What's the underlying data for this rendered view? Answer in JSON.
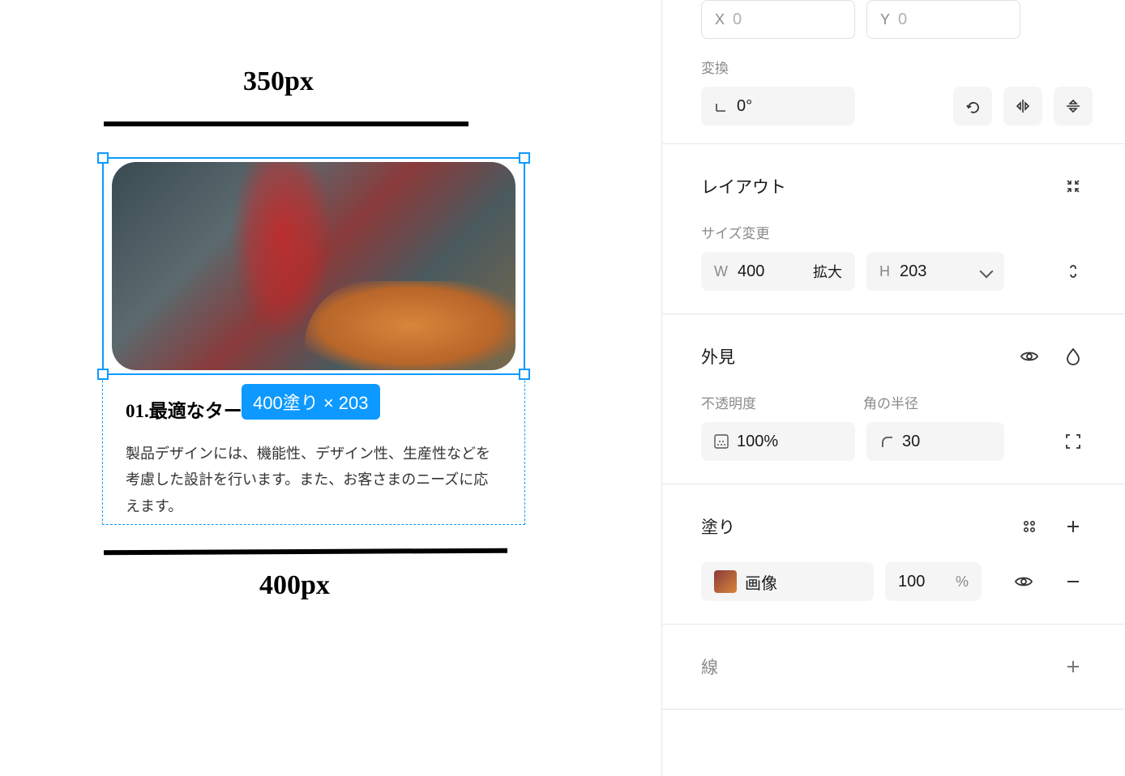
{
  "canvas": {
    "top_label": "350px",
    "bottom_label": "400px",
    "card_title": "01.最適なターゲット設定",
    "card_body": "製品デザインには、機能性、デザイン性、生産性などを考慮した設計を行います。また、お客さまのニーズに応えます。",
    "selection_badge": "400塗り × 203"
  },
  "panel": {
    "position": {
      "x_label": "X",
      "x_value": "0",
      "y_label": "Y",
      "y_value": "0"
    },
    "transform": {
      "section_label": "変換",
      "rotation_value": "0°"
    },
    "layout": {
      "title": "レイアウト",
      "resize_label": "サイズ変更",
      "w_label": "W",
      "w_value": "400",
      "w_mode": "拡大",
      "h_label": "H",
      "h_value": "203"
    },
    "appearance": {
      "title": "外見",
      "opacity_label": "不透明度",
      "opacity_value": "100%",
      "radius_label": "角の半径",
      "radius_value": "30"
    },
    "fill": {
      "title": "塗り",
      "type_label": "画像",
      "opacity_value": "100",
      "opacity_unit": "%"
    },
    "stroke": {
      "title": "線"
    }
  }
}
